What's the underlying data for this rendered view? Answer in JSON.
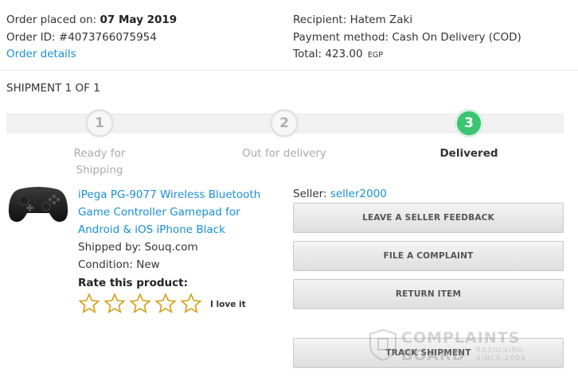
{
  "order": {
    "placed_label": "Order placed on:",
    "placed_date": "07 May 2019",
    "id_label": "Order ID:",
    "id_value": "#4073766075954",
    "details_link": "Order details",
    "recipient": "Recipient: Hatem Zaki",
    "payment": "Payment method: Cash On Delivery (COD)",
    "total_label": "Total: 423.00",
    "total_currency": "EGP"
  },
  "shipment": {
    "title": "SHIPMENT 1 OF 1",
    "steps": [
      {
        "num": "1",
        "label_line1": "Ready for",
        "label_line2": "Shipping"
      },
      {
        "num": "2",
        "label_line1": "Out for delivery"
      },
      {
        "num": "3",
        "label_line1": "Delivered"
      }
    ],
    "current_step": 3
  },
  "product": {
    "title_line1": "iPega PG-9077 Wireless Bluetooth",
    "title_line2": "Game Controller Gamepad for",
    "title_line3": "Android & iOS iPhone Black",
    "shipped_by": "Shipped by: Souq.com",
    "condition": "Condition: New",
    "rate_label": "Rate this product:",
    "rating": 0,
    "rating_text": "I love it"
  },
  "seller": {
    "label": "Seller:",
    "name": "seller2000"
  },
  "actions": {
    "feedback": "LEAVE A SELLER FEEDBACK",
    "complaint": "FILE A COMPLAINT",
    "return": "RETURN ITEM",
    "track": "TRACK SHIPMENT"
  },
  "watermark": {
    "line1": "COMPLAINTS",
    "line2": "BOARD",
    "tag1": "RESOLVING",
    "tag2": "SINCE 2004"
  },
  "colors": {
    "link": "#1a8fd6",
    "success": "#3bc472",
    "star": "#d4a017"
  }
}
